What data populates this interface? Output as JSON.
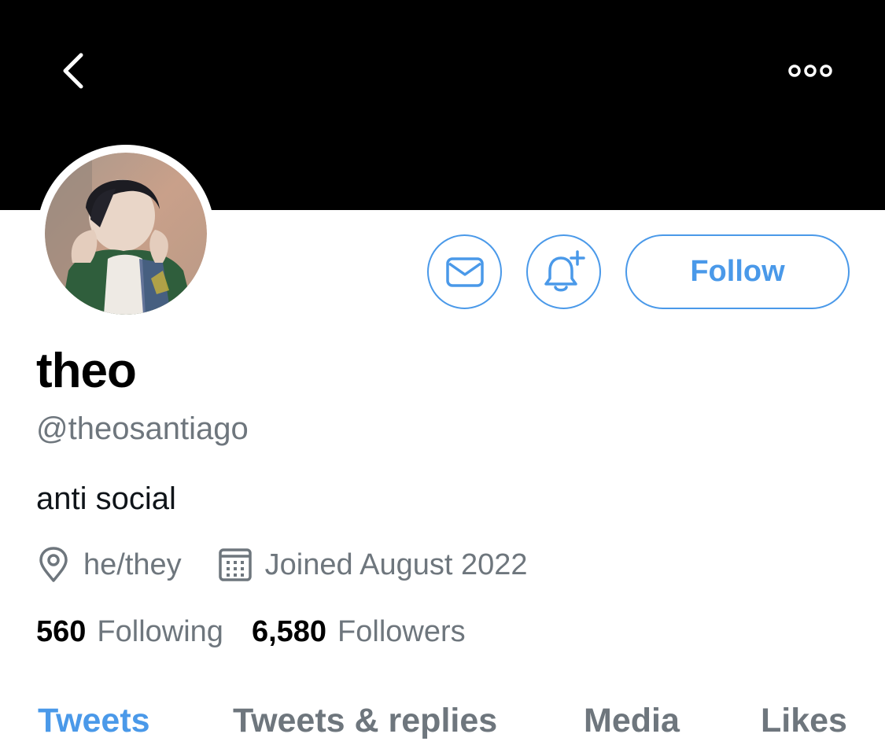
{
  "profile": {
    "name": "theo",
    "handle": "@theosantiago",
    "bio": "anti social",
    "location": "he/they",
    "joined": "Joined August 2022"
  },
  "stats": {
    "following_count": "560",
    "following_label": "Following",
    "followers_count": "6,580",
    "followers_label": "Followers"
  },
  "actions": {
    "follow_label": "Follow"
  },
  "tabs": [
    {
      "label": "Tweets",
      "active": true
    },
    {
      "label": "Tweets & replies",
      "active": false
    },
    {
      "label": "Media",
      "active": false
    },
    {
      "label": "Likes",
      "active": false
    }
  ],
  "icons": {
    "back": "chevron-left-icon",
    "more": "more-horizontal-icon",
    "message": "envelope-icon",
    "notify": "bell-plus-icon",
    "location": "map-pin-icon",
    "calendar": "calendar-icon"
  },
  "colors": {
    "accent": "#4a99e9",
    "muted": "#6e767d",
    "banner": "#000000"
  }
}
